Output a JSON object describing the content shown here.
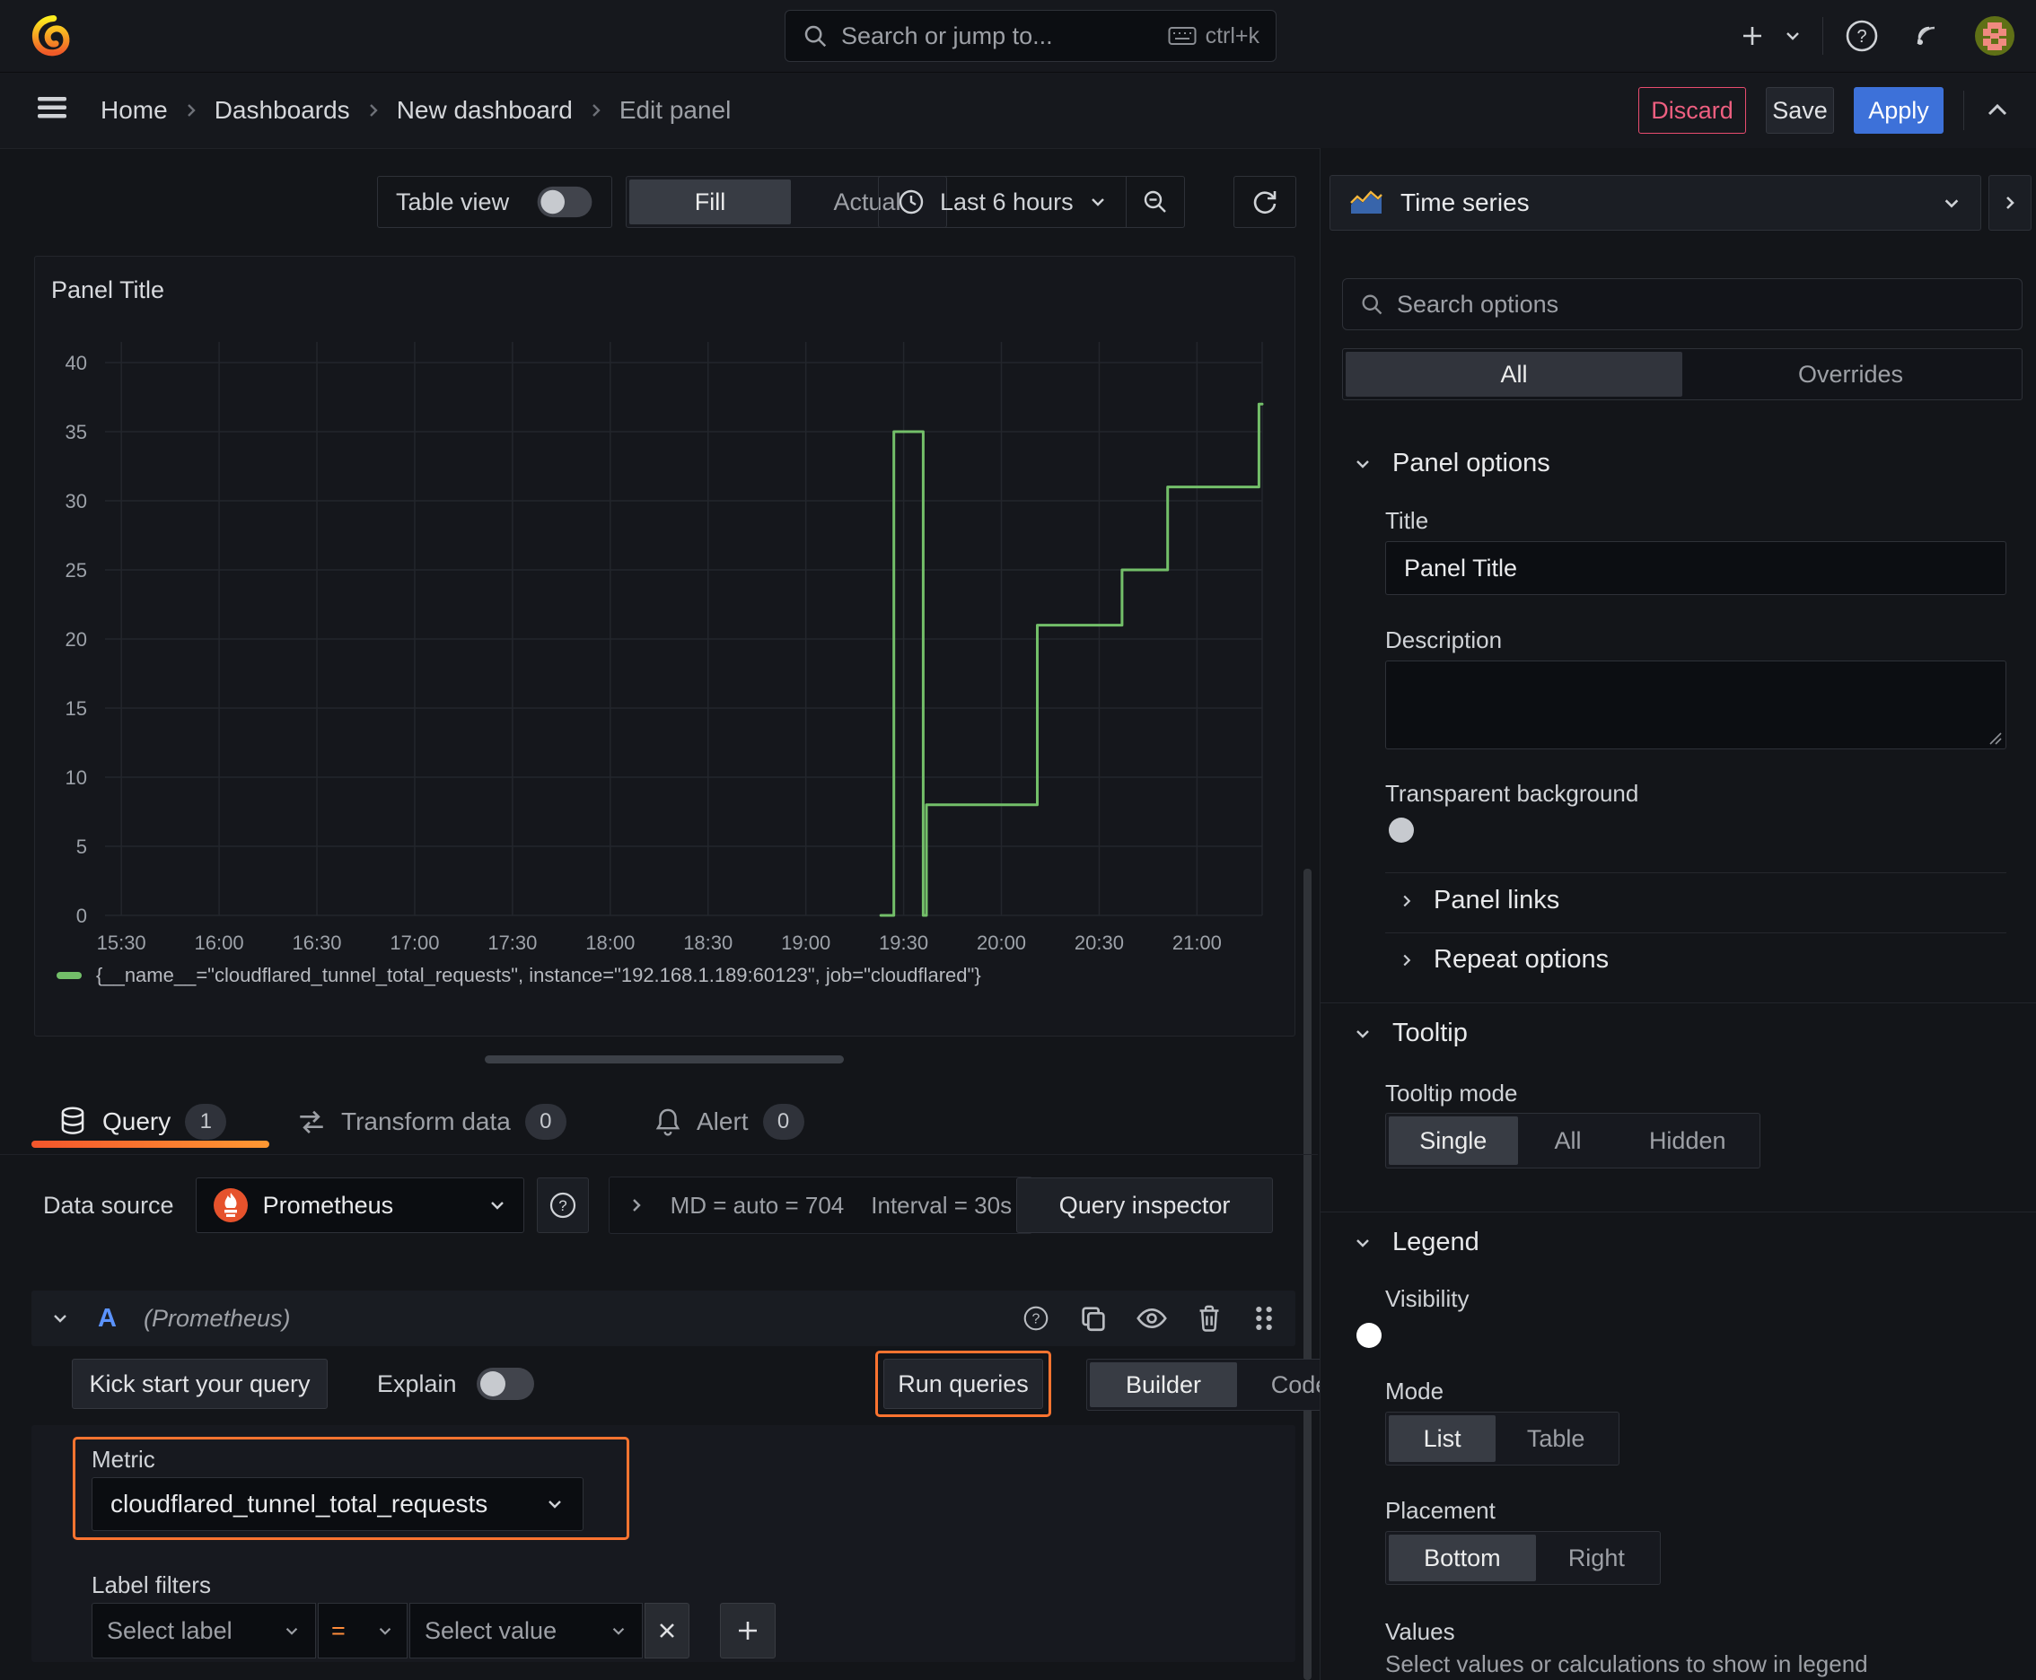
{
  "colors": {
    "accent_orange": "#ff7430",
    "apply_blue": "#3d71d9",
    "series_green": "#73bf69",
    "discard_pink": "#e84c6f"
  },
  "topbar": {
    "search_placeholder": "Search or jump to...",
    "search_shortcut": "ctrl+k"
  },
  "breadcrumb": {
    "items": [
      "Home",
      "Dashboards",
      "New dashboard",
      "Edit panel"
    ],
    "discard": "Discard",
    "save": "Save",
    "apply": "Apply"
  },
  "toolbar": {
    "table_view": "Table view",
    "fill": "Fill",
    "actual": "Actual",
    "time_range": "Last 6 hours"
  },
  "viz_picker": {
    "label": "Time series"
  },
  "options": {
    "search_placeholder": "Search options",
    "tab_all": "All",
    "tab_overrides": "Overrides",
    "panel_options": {
      "heading": "Panel options",
      "title_label": "Title",
      "title_value": "Panel Title",
      "description_label": "Description",
      "transparent_label": "Transparent background"
    },
    "panel_links": "Panel links",
    "repeat_options": "Repeat options",
    "tooltip": {
      "heading": "Tooltip",
      "mode_label": "Tooltip mode",
      "modes": [
        "Single",
        "All",
        "Hidden"
      ],
      "selected": "Single"
    },
    "legend": {
      "heading": "Legend",
      "visibility_label": "Visibility",
      "mode_label": "Mode",
      "modes": [
        "List",
        "Table"
      ],
      "selected_mode": "List",
      "placement_label": "Placement",
      "placements": [
        "Bottom",
        "Right"
      ],
      "selected_placement": "Bottom",
      "values_label": "Values",
      "values_help": "Select values or calculations to show in legend"
    }
  },
  "tabs": {
    "query": "Query",
    "query_count": "1",
    "transform": "Transform data",
    "transform_count": "0",
    "alert": "Alert",
    "alert_count": "0"
  },
  "query_row": {
    "datasource_label": "Data source",
    "datasource": "Prometheus",
    "md": "MD = auto = 704",
    "interval": "Interval = 30s",
    "inspector": "Query inspector"
  },
  "query_a": {
    "refid": "A",
    "ds_hint": "(Prometheus)",
    "kick_start": "Kick start your query",
    "explain": "Explain",
    "run": "Run queries",
    "builder": "Builder",
    "code": "Code",
    "metric_label": "Metric",
    "metric_value": "cloudflared_tunnel_total_requests",
    "label_filters_label": "Label filters",
    "select_label": "Select label",
    "operator": "=",
    "select_value": "Select value"
  },
  "chart_data": {
    "type": "line",
    "line_style": "stepped",
    "title": "Panel Title",
    "xlabel": "",
    "ylabel": "",
    "ylim": [
      0,
      42
    ],
    "grid": true,
    "legend_position": "bottom",
    "x_start": "15:25",
    "x_end": "21:20",
    "x_ticks": [
      "15:30",
      "16:00",
      "16:30",
      "17:00",
      "17:30",
      "18:00",
      "18:30",
      "19:00",
      "19:30",
      "20:00",
      "20:30",
      "21:00"
    ],
    "y_ticks": [
      0,
      5,
      10,
      15,
      20,
      25,
      30,
      35,
      40
    ],
    "series": [
      {
        "name": "{__name__=\"cloudflared_tunnel_total_requests\", instance=\"192.168.1.189:60123\", job=\"cloudflared\"}",
        "color": "#73bf69",
        "points": [
          [
            "19:23",
            0
          ],
          [
            "19:27",
            0
          ],
          [
            "19:27",
            35
          ],
          [
            "19:36",
            35
          ],
          [
            "19:36",
            0
          ],
          [
            "19:37",
            0
          ],
          [
            "19:37",
            8
          ],
          [
            "20:11",
            8
          ],
          [
            "20:11",
            21
          ],
          [
            "20:37",
            21
          ],
          [
            "20:37",
            25
          ],
          [
            "20:51",
            25
          ],
          [
            "20:51",
            31
          ],
          [
            "21:19",
            31
          ],
          [
            "21:19",
            37
          ],
          [
            "21:20",
            37
          ]
        ]
      }
    ]
  }
}
